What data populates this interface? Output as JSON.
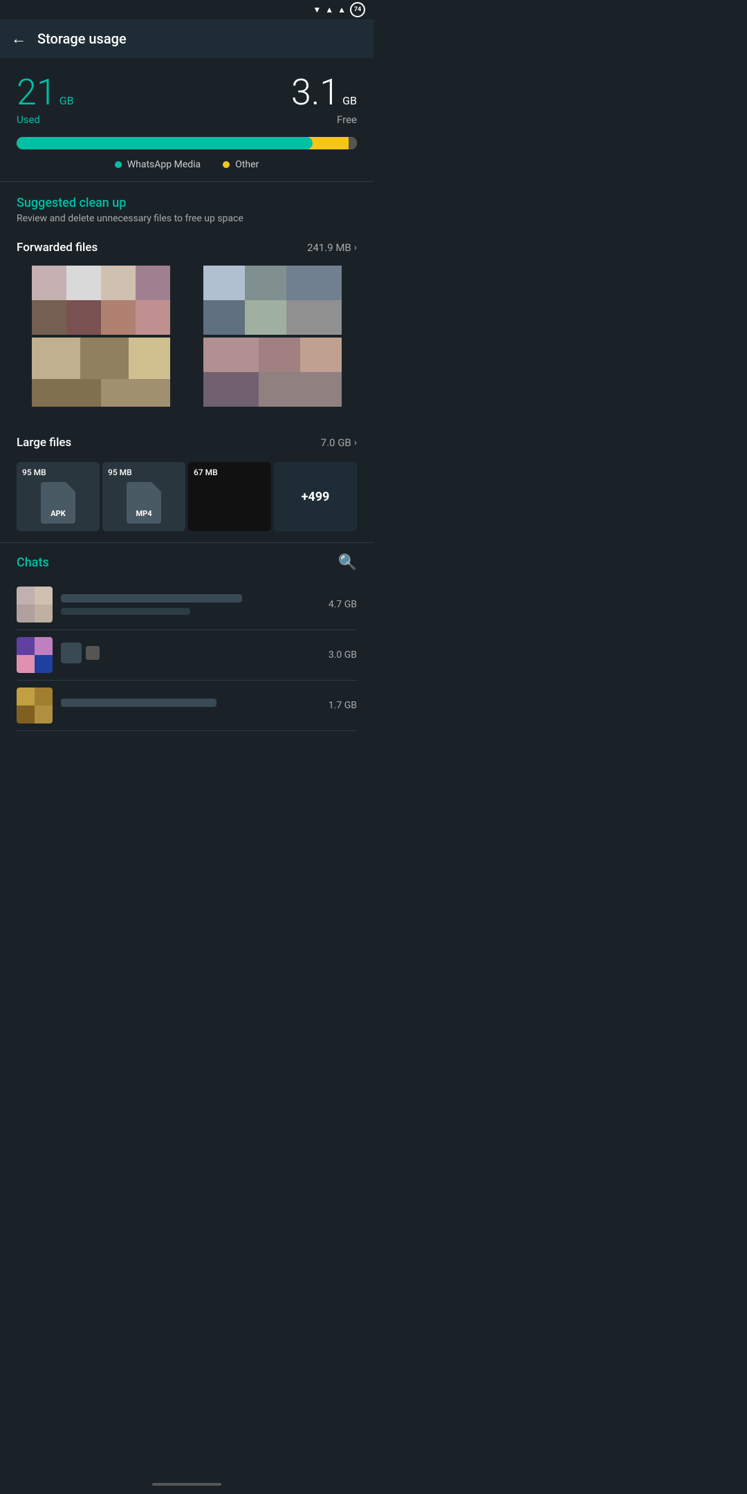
{
  "statusBar": {
    "battery": "74"
  },
  "header": {
    "title": "Storage usage",
    "backLabel": "←"
  },
  "storage": {
    "usedNumber": "21",
    "usedUnit": "GB",
    "usedLabel": "Used",
    "freeNumber": "3.1",
    "freeUnit": "GB",
    "freeLabel": "Free",
    "usedPercent": 87,
    "legend": {
      "whatsappMedia": "WhatsApp Media",
      "other": "Other"
    }
  },
  "cleanup": {
    "title": "Suggested clean up",
    "description": "Review and delete unnecessary files to free up space"
  },
  "forwardedFiles": {
    "label": "Forwarded files",
    "size": "241.9 MB",
    "chevron": "›"
  },
  "largeFiles": {
    "label": "Large files",
    "size": "7.0 GB",
    "chevron": "›",
    "files": [
      {
        "size": "95 MB",
        "type": "APK"
      },
      {
        "size": "95 MB",
        "type": "MP4"
      },
      {
        "size": "67 MB",
        "type": ""
      },
      {
        "size": "",
        "type": "+499"
      }
    ]
  },
  "chats": {
    "title": "Chats",
    "searchIcon": "🔍",
    "items": [
      {
        "size": "4.7 GB"
      },
      {
        "size": "3.0 GB"
      },
      {
        "size": "1.7 GB"
      }
    ]
  },
  "bottomBar": {}
}
